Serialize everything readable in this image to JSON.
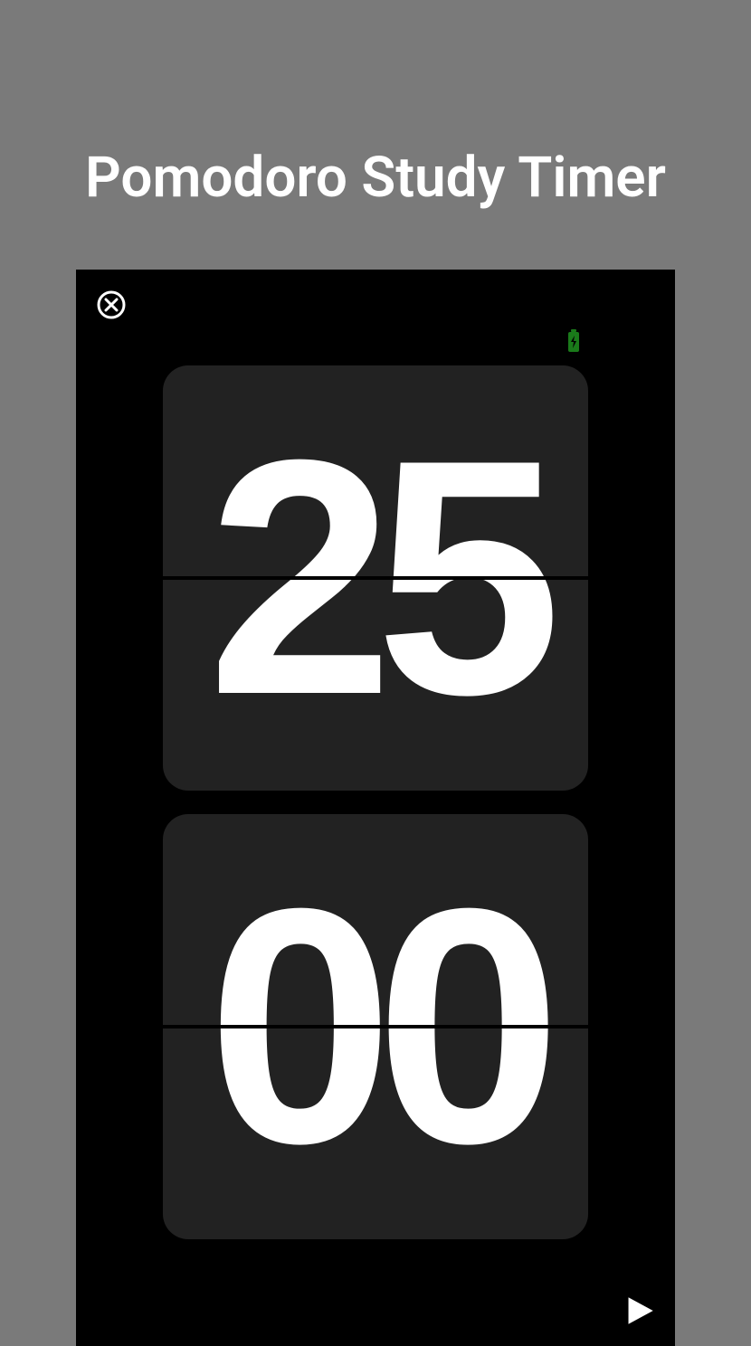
{
  "title": "Pomodoro Study Timer",
  "timer": {
    "minutes": "25",
    "seconds": "00"
  },
  "icons": {
    "close": "close-circle",
    "battery": "battery-charging",
    "play": "play"
  },
  "colors": {
    "background": "#7a7a7a",
    "app_bg": "#000000",
    "card_bg": "#222222",
    "text": "#ffffff",
    "battery": "#1a7a1a"
  }
}
